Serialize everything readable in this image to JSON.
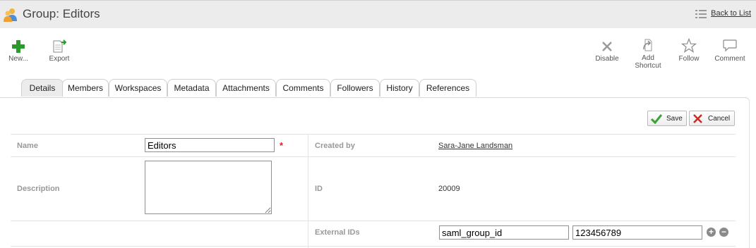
{
  "header": {
    "title": "Group: Editors",
    "back_label": "Back to List",
    "group_icon": "group-icon",
    "list_icon": "list-icon"
  },
  "toolbar": {
    "new_label": "New...",
    "export_label": "Export",
    "disable_label": "Disable",
    "add_shortcut_label_1": "Add",
    "add_shortcut_label_2": "Shortcut",
    "follow_label": "Follow",
    "comment_label": "Comment"
  },
  "tabs": [
    {
      "label": "Details",
      "active": true
    },
    {
      "label": "Members"
    },
    {
      "label": "Workspaces"
    },
    {
      "label": "Metadata"
    },
    {
      "label": "Attachments"
    },
    {
      "label": "Comments"
    },
    {
      "label": "Followers"
    },
    {
      "label": "History"
    },
    {
      "label": "References"
    }
  ],
  "actions": {
    "save_label": "Save",
    "cancel_label": "Cancel"
  },
  "form": {
    "name_label": "Name",
    "name_value": "Editors",
    "required_mark": "*",
    "description_label": "Description",
    "description_value": "",
    "created_by_label": "Created by",
    "created_by_value": "Sara-Jane Landsman",
    "id_label": "ID",
    "id_value": "20009",
    "external_ids_label": "External IDs",
    "external_id_key": "saml_group_id",
    "external_id_value": "123456789",
    "add_symbol": "+",
    "remove_symbol": "−"
  },
  "colors": {
    "save_accent": "#3aa335",
    "cancel_accent": "#d9241c",
    "new_accent": "#2a9a2a",
    "required": "#e02020"
  }
}
